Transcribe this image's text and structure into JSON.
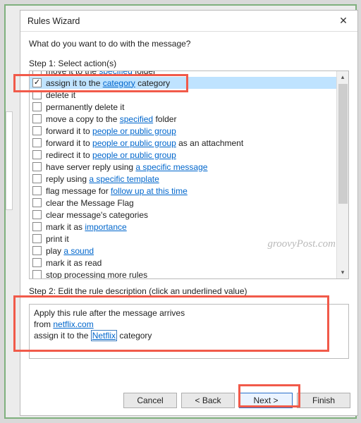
{
  "window": {
    "title": "Rules Wizard",
    "close_glyph": "✕"
  },
  "prompt": "What do you want to do with the message?",
  "step1_label": "Step 1: Select action(s)",
  "actions": [
    {
      "pre": "move it to the ",
      "link": "specified",
      "post": " folder",
      "checked": false
    },
    {
      "pre": "assign it to the ",
      "link": "category",
      "post": " category",
      "checked": true,
      "selected": true
    },
    {
      "pre": "delete it",
      "link": "",
      "post": "",
      "checked": false
    },
    {
      "pre": "permanently delete it",
      "link": "",
      "post": "",
      "checked": false
    },
    {
      "pre": "move a copy to the ",
      "link": "specified",
      "post": " folder",
      "checked": false
    },
    {
      "pre": "forward it to ",
      "link": "people or public group",
      "post": "",
      "checked": false
    },
    {
      "pre": "forward it to ",
      "link": "people or public group",
      "post": " as an attachment",
      "checked": false
    },
    {
      "pre": "redirect it to ",
      "link": "people or public group",
      "post": "",
      "checked": false
    },
    {
      "pre": "have server reply using ",
      "link": "a specific message",
      "post": "",
      "checked": false
    },
    {
      "pre": "reply using ",
      "link": "a specific template",
      "post": "",
      "checked": false
    },
    {
      "pre": "flag message for ",
      "link": "follow up at this time",
      "post": "",
      "checked": false
    },
    {
      "pre": "clear the Message Flag",
      "link": "",
      "post": "",
      "checked": false
    },
    {
      "pre": "clear message's categories",
      "link": "",
      "post": "",
      "checked": false
    },
    {
      "pre": "mark it as ",
      "link": "importance",
      "post": "",
      "checked": false
    },
    {
      "pre": "print it",
      "link": "",
      "post": "",
      "checked": false
    },
    {
      "pre": "play ",
      "link": "a sound",
      "post": "",
      "checked": false
    },
    {
      "pre": "mark it as read",
      "link": "",
      "post": "",
      "checked": false
    },
    {
      "pre": "stop processing more rules",
      "link": "",
      "post": "",
      "checked": false
    }
  ],
  "step2_label": "Step 2: Edit the rule description (click an underlined value)",
  "description": {
    "line1": "Apply this rule after the message arrives",
    "line2_pre": "from ",
    "line2_link": "netflix.com",
    "line3_pre": "assign it to the ",
    "line3_link": "Netflix",
    "line3_post": " category"
  },
  "buttons": {
    "cancel": "Cancel",
    "back": "< Back",
    "next": "Next >",
    "finish": "Finish"
  },
  "watermark": "groovyPost.com",
  "scroll": {
    "up": "▴",
    "down": "▾"
  }
}
